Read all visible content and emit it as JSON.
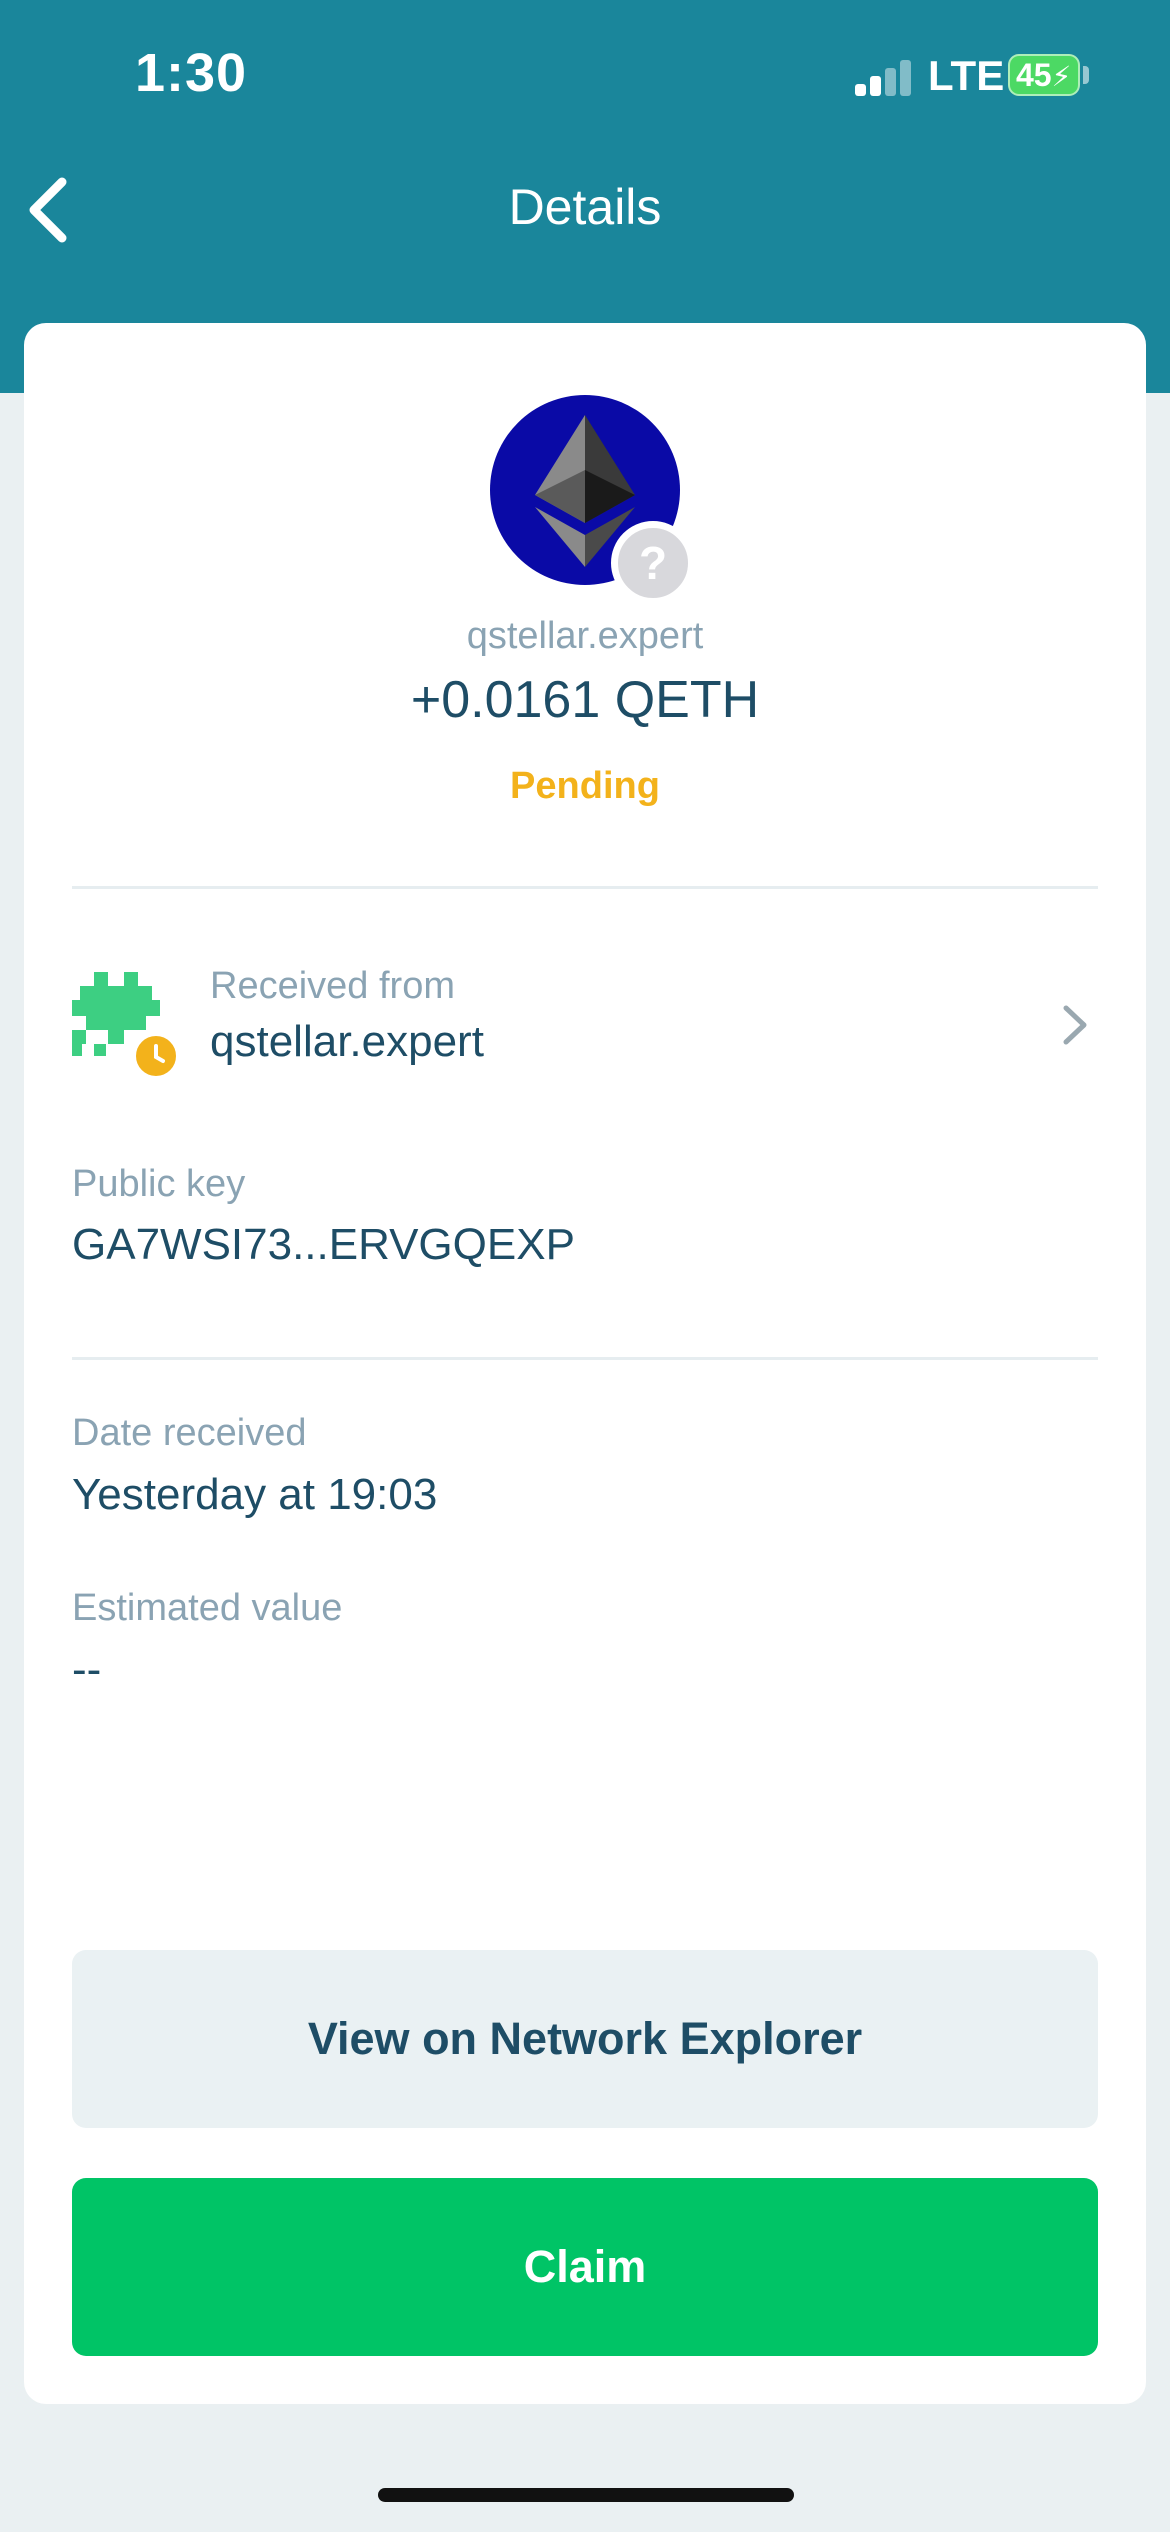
{
  "status_bar": {
    "time": "1:30",
    "network": "LTE",
    "battery": "45"
  },
  "header": {
    "title": "Details",
    "back_icon": "chevron-left-icon"
  },
  "asset": {
    "domain": "qstellar.expert",
    "amount": "+0.0161 QETH",
    "status": "Pending",
    "icon": "ethereum-icon",
    "badge_icon": "question-mark-icon",
    "badge_text": "?"
  },
  "sender": {
    "label": "Received from",
    "name": "qstellar.expert",
    "avatar_icon": "identicon-avatar",
    "badge_icon": "clock-icon"
  },
  "public_key": {
    "label": "Public key",
    "value": "GA7WSI73...ERVGQEXP"
  },
  "date": {
    "label": "Date received",
    "value": "Yesterday at 19:03"
  },
  "estimated": {
    "label": "Estimated value",
    "value": "--"
  },
  "actions": {
    "explorer_label": "View on Network Explorer",
    "claim_label": "Claim"
  },
  "colors": {
    "header": "#1a869b",
    "page_bg": "#eaf0f2",
    "pending": "#f3b21b",
    "claim": "#00c466",
    "identicon": "#3dcf82",
    "eth_bg": "#0a0aa6"
  }
}
